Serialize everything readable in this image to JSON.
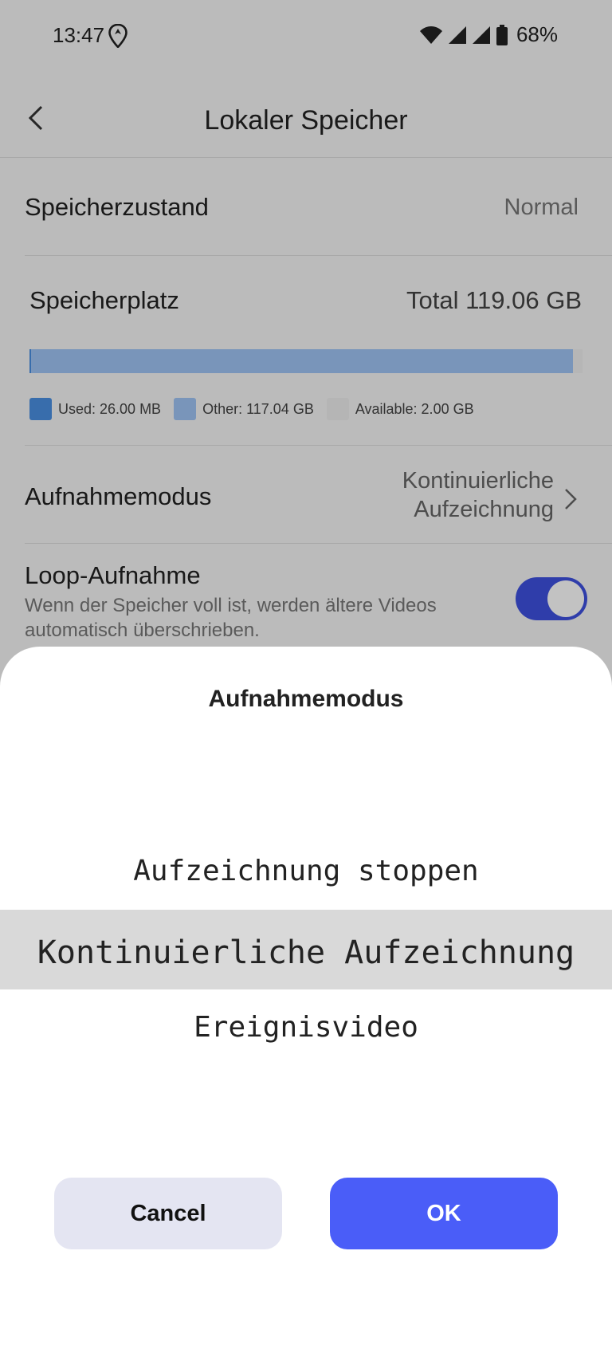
{
  "status": {
    "time": "13:47",
    "battery": "68%"
  },
  "appbar": {
    "title": "Lokaler Speicher"
  },
  "storage_state": {
    "label": "Speicherzustand",
    "value": "Normal"
  },
  "storage_space": {
    "label": "Speicherplatz",
    "total": "Total 119.06 GB",
    "legend": {
      "used": "Used: 26.00 MB",
      "other": "Other: 117.04 GB",
      "available": "Available: 2.00 GB"
    },
    "used_fraction": 0.0002,
    "other_fraction": 0.983
  },
  "recording_mode": {
    "label": "Aufnahmemodus",
    "value_line1": "Kontinuierliche",
    "value_line2": "Aufzeichnung"
  },
  "loop_recording": {
    "label": "Loop-Aufnahme",
    "description_line1": "Wenn der Speicher voll ist, werden ältere Videos",
    "description_line2": "automatisch überschrieben.",
    "enabled": true
  },
  "sheet": {
    "title": "Aufnahmemodus",
    "options": [
      "Aufzeichnung stoppen",
      "Kontinuierliche Aufzeichnung",
      "Ereignisvideo"
    ],
    "selected": "Kontinuierliche Aufzeichnung",
    "cancel_label": "Cancel",
    "ok_label": "OK"
  },
  "colors": {
    "used": "#4a90e2",
    "other": "#9fc4f5",
    "available": "#eeeeee",
    "accent": "#4a5df8",
    "toggle": "#3f51e0"
  }
}
